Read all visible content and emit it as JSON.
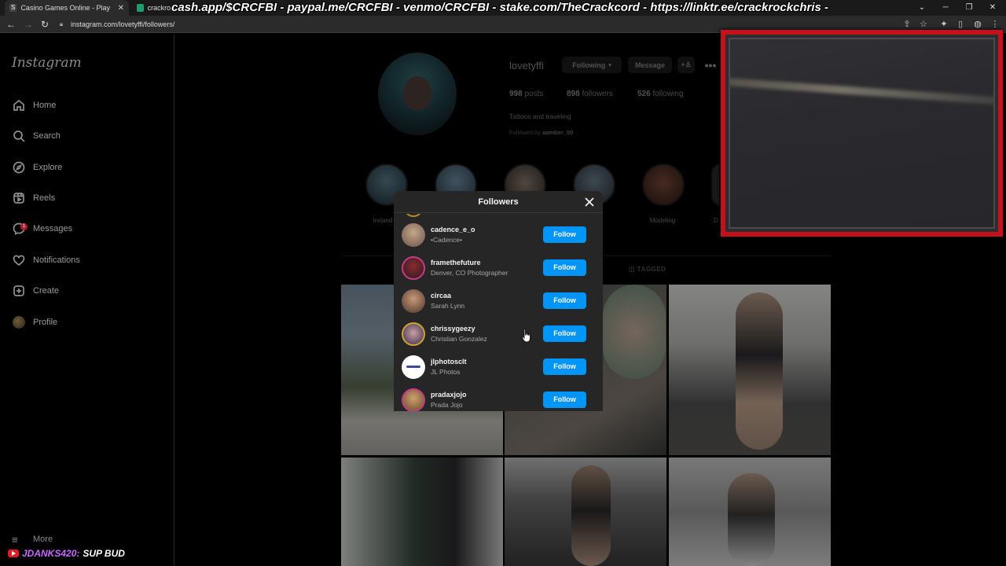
{
  "browser": {
    "tabs": [
      {
        "title": "Casino Games Online - Play Best",
        "favicon": "S"
      },
      {
        "title": "crackrockchris - BGS, Baby!",
        "favicon": "twitch"
      }
    ],
    "overlay_banner": "cash.app/$CRCFBI - paypal.me/CRCFBI - venmo/CRCFBI - stake.com/TheCrackcord - https://linktr.ee/crackrockchris -",
    "url": "instagram.com/lovetyffi/followers/"
  },
  "sidebar": {
    "logo": "Instagram",
    "items": [
      {
        "label": "Home",
        "icon": "home-icon"
      },
      {
        "label": "Search",
        "icon": "search-icon"
      },
      {
        "label": "Explore",
        "icon": "compass-icon"
      },
      {
        "label": "Reels",
        "icon": "reels-icon"
      },
      {
        "label": "Messages",
        "icon": "messenger-icon",
        "badge": "1"
      },
      {
        "label": "Notifications",
        "icon": "heart-icon"
      },
      {
        "label": "Create",
        "icon": "plus-square-icon"
      },
      {
        "label": "Profile",
        "icon": "avatar"
      }
    ],
    "more": "More"
  },
  "profile": {
    "username": "lovetyffi",
    "following_button": "Following",
    "message_button": "Message",
    "posts_count": "998",
    "posts_label": "posts",
    "followers_count": "898",
    "followers_label": "followers",
    "following_count": "526",
    "following_label": "following",
    "bio": "Tattoos and traveling",
    "followed_by_prefix": "Followed by",
    "followed_by_user": "aamber_00",
    "highlights": [
      "Ireland",
      "",
      "",
      "",
      "Modeling",
      "D"
    ],
    "tagged_tab": "TAGGED"
  },
  "followers_dialog": {
    "title": "Followers",
    "items": [
      {
        "username": "cadence_e_o",
        "name": "•Cadence•",
        "button": "Follow"
      },
      {
        "username": "framethefuture",
        "name": "Denver, CO Photographer",
        "button": "Follow"
      },
      {
        "username": "circaa",
        "name": "Sarah Lynn",
        "button": "Follow"
      },
      {
        "username": "chrissygeezy",
        "name": "Christian Gonzalez",
        "button": "Follow"
      },
      {
        "username": "jlphotosclt",
        "name": "JL Photos",
        "button": "Follow"
      },
      {
        "username": "pradaxjojo",
        "name": "Prada Jojo",
        "button": "Follow"
      }
    ]
  },
  "chat": {
    "user": "JDANKS420:",
    "message": "SUP BUD"
  },
  "colors": {
    "follow_button": "#0095f6",
    "webcam_border": "#c4111b",
    "chat_user": "#c76bff"
  }
}
